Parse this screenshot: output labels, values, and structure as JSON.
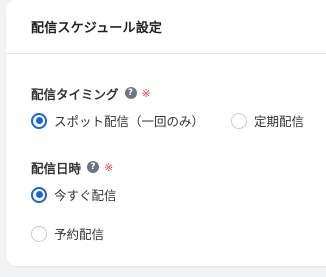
{
  "card": {
    "title": "配信スケジュール設定"
  },
  "timing": {
    "label": "配信タイミング",
    "help_icon": "question-circle-icon",
    "help_glyph": "?",
    "required": "※",
    "options": [
      {
        "label": "スポット配信（一回のみ）",
        "checked": true
      },
      {
        "label": "定期配信",
        "checked": false
      }
    ]
  },
  "datetime": {
    "label": "配信日時",
    "help_icon": "question-circle-icon",
    "help_glyph": "?",
    "required": "※",
    "options": [
      {
        "label": "今すぐ配信",
        "checked": true
      },
      {
        "label": "予約配信",
        "checked": false
      }
    ]
  },
  "colors": {
    "accent": "#1a64d6",
    "required": "#e0423f",
    "background": "#f2f3f5",
    "card": "#ffffff"
  }
}
